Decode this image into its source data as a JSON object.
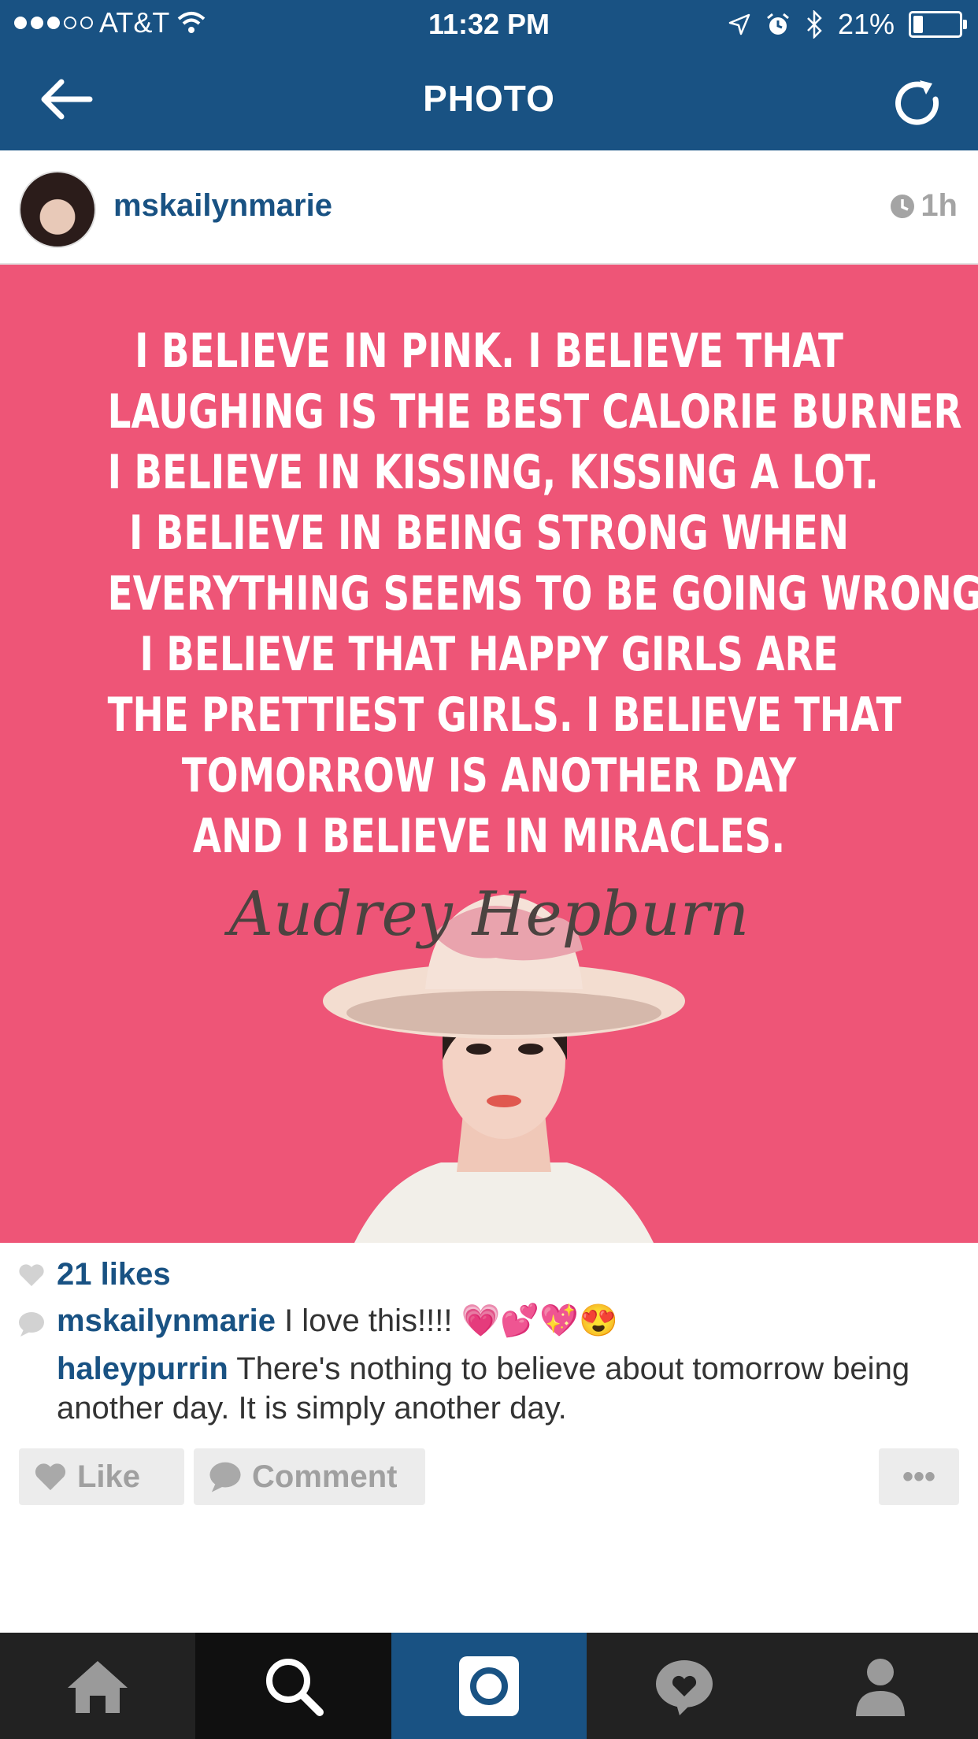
{
  "status_bar": {
    "carrier": "AT&T",
    "time": "11:32 PM",
    "battery": "21%",
    "battery_level": 0.21,
    "signal_bars": 3,
    "icons": [
      "wifi-icon",
      "location-icon",
      "alarm-icon",
      "bluetooth-icon",
      "battery-icon"
    ]
  },
  "nav": {
    "title": "PHOTO",
    "icons": [
      "back-arrow-icon",
      "refresh-icon"
    ]
  },
  "post": {
    "username": "mskailynmarie",
    "time_ago": "1h",
    "image": {
      "quote_lines": [
        "I BELIEVE IN PINK. I BELIEVE THAT",
        "LAUGHING IS THE BEST CALORIE BURNER",
        "I BELIEVE IN KISSING, KISSING A LOT.",
        "I BELIEVE IN BEING STRONG WHEN",
        "EVERYTHING SEEMS TO BE GOING WRONG.",
        "I BELIEVE THAT HAPPY GIRLS ARE",
        "THE PRETTIEST GIRLS. I BELIEVE THAT",
        "TOMORROW IS ANOTHER DAY",
        "AND I BELIEVE IN MIRACLES."
      ],
      "signature": "Audrey Hepburn",
      "background_color": "#ee5577"
    },
    "likes": "21 likes",
    "comments": [
      {
        "author": "mskailynmarie",
        "text": "I love this!!!! 💗💕💖😍"
      },
      {
        "author": "haleypurrin",
        "text": "There's nothing to believe about tomorrow being another day. It is simply another day."
      }
    ]
  },
  "actions": {
    "like_label": "Like",
    "comment_label": "Comment",
    "more_label": "•••"
  },
  "tabbar": {
    "tabs": [
      "home-icon",
      "search-icon",
      "camera-icon",
      "activity-icon",
      "profile-icon"
    ],
    "active": "camera"
  },
  "colors": {
    "brand_blue": "#195283",
    "pink": "#ee5577",
    "tab_bar": "#222222"
  }
}
